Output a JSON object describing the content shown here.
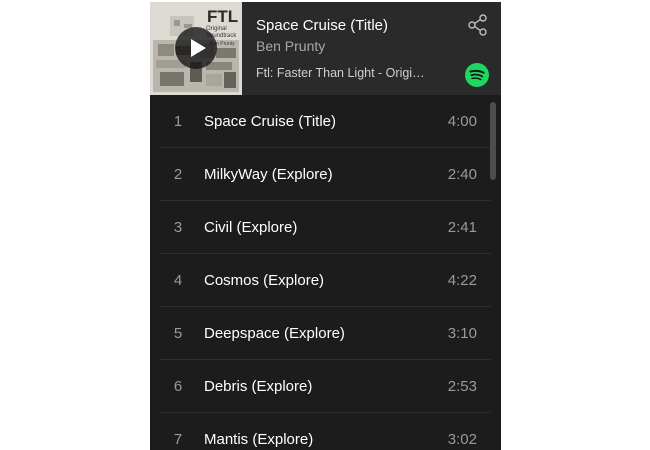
{
  "now_playing": {
    "title": "Space Cruise (Title)",
    "artist": "Ben Prunty",
    "album": "Ftl: Faster Than Light - Original Soundtrack",
    "cover": {
      "logo_text": "FTL",
      "subtitle_lines": [
        "Original",
        "Soundtrack"
      ],
      "credit": "Ben Prunty"
    }
  },
  "icons": {
    "play": "play-icon",
    "share": "share-icon",
    "brand": "spotify-icon"
  },
  "colors": {
    "background": "#1c1c1c",
    "header": "#2a2a2a",
    "brand_green": "#1ed760",
    "secondary_text": "#9a9a9a"
  },
  "tracks": [
    {
      "number": "1",
      "name": "Space Cruise (Title)",
      "duration": "4:00"
    },
    {
      "number": "2",
      "name": "MilkyWay (Explore)",
      "duration": "2:40"
    },
    {
      "number": "3",
      "name": "Civil (Explore)",
      "duration": "2:41"
    },
    {
      "number": "4",
      "name": "Cosmos (Explore)",
      "duration": "4:22"
    },
    {
      "number": "5",
      "name": "Deepspace (Explore)",
      "duration": "3:10"
    },
    {
      "number": "6",
      "name": "Debris (Explore)",
      "duration": "2:53"
    },
    {
      "number": "7",
      "name": "Mantis (Explore)",
      "duration": "3:02"
    }
  ]
}
